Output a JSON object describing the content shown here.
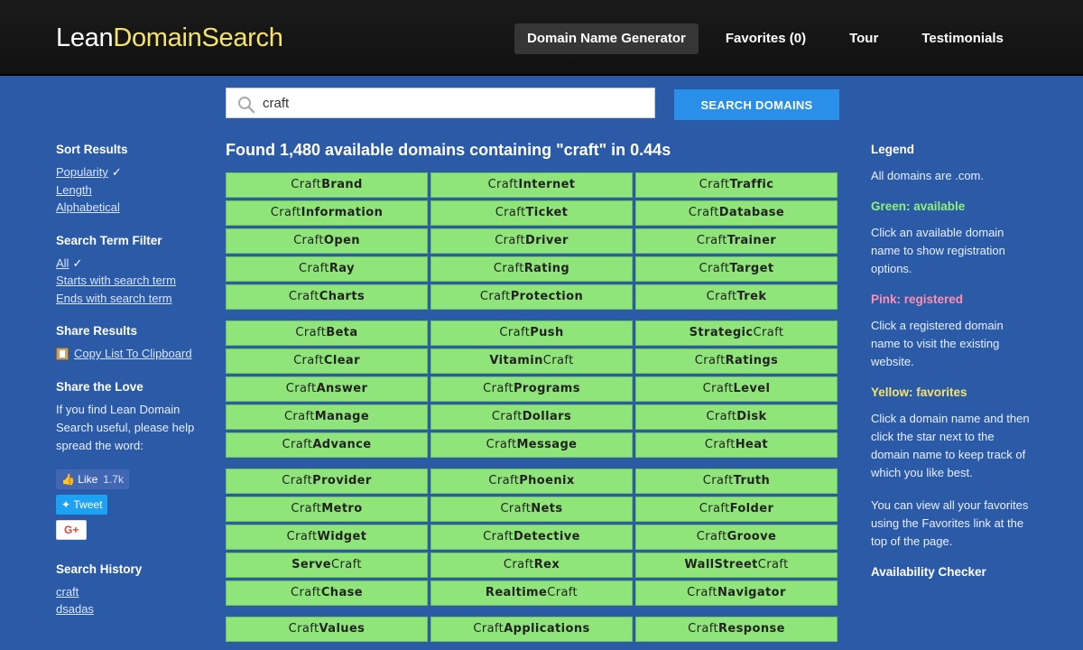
{
  "logo": {
    "part1": "Lean",
    "part2": "DomainSearch"
  },
  "nav": [
    "Domain Name Generator",
    "Favorites (0)",
    "Tour",
    "Testimonials"
  ],
  "search": {
    "value": "craft",
    "button": "SEARCH DOMAINS"
  },
  "result_heading": "Found 1,480 available domains containing \"craft\" in 0.44s",
  "left": {
    "sort_heading": "Sort Results",
    "sort_items": [
      "Popularity",
      "Length",
      "Alphabetical"
    ],
    "check": "✓",
    "filter_heading": "Search Term Filter",
    "filter_items": [
      "All",
      "Starts with search term",
      "Ends with search term"
    ],
    "share_heading": "Share Results",
    "copy_link": "Copy List To Clipboard",
    "love_heading": "Share the Love",
    "love_text": "If you find Lean Domain Search useful, please help spread the word:",
    "like": "Like",
    "like_count": "1.7k",
    "tweet": "Tweet",
    "gplus": "G+",
    "history_heading": "Search History",
    "history": [
      "craft",
      "dsadas"
    ]
  },
  "right": {
    "legend_heading": "Legend",
    "all_com": "All domains are .com.",
    "green_label": "Green: available",
    "green_text": "Click an available domain name to show registration options.",
    "pink_label": "Pink: registered",
    "pink_text": "Click a registered domain name to visit the existing website.",
    "yellow_label": "Yellow: favorites",
    "yellow_text": "Click a domain name and then click the star next to the domain name to keep track of which you like best.",
    "fav_text": "You can view all your favorites using the Favorites link at the top of the page.",
    "checker_heading": "Availability Checker"
  },
  "domains": [
    [
      [
        "Craft",
        "Brand"
      ],
      [
        "Craft",
        "Internet"
      ],
      [
        "Craft",
        "Traffic"
      ]
    ],
    [
      [
        "Craft",
        "Information"
      ],
      [
        "Craft",
        "Ticket"
      ],
      [
        "Craft",
        "Database"
      ]
    ],
    [
      [
        "Craft",
        "Open"
      ],
      [
        "Craft",
        "Driver"
      ],
      [
        "Craft",
        "Trainer"
      ]
    ],
    [
      [
        "Craft",
        "Ray"
      ],
      [
        "Craft",
        "Rating"
      ],
      [
        "Craft",
        "Target"
      ]
    ],
    [
      [
        "Craft",
        "Charts"
      ],
      [
        "Craft",
        "Protection"
      ],
      [
        "Craft",
        "Trek"
      ]
    ],
    [
      [
        "Craft",
        "Beta"
      ],
      [
        "Craft",
        "Push"
      ],
      [
        "Strategic",
        "Craft"
      ]
    ],
    [
      [
        "Craft",
        "Clear"
      ],
      [
        "Vitamin",
        "Craft"
      ],
      [
        "Craft",
        "Ratings"
      ]
    ],
    [
      [
        "Craft",
        "Answer"
      ],
      [
        "Craft",
        "Programs"
      ],
      [
        "Craft",
        "Level"
      ]
    ],
    [
      [
        "Craft",
        "Manage"
      ],
      [
        "Craft",
        "Dollars"
      ],
      [
        "Craft",
        "Disk"
      ]
    ],
    [
      [
        "Craft",
        "Advance"
      ],
      [
        "Craft",
        "Message"
      ],
      [
        "Craft",
        "Heat"
      ]
    ],
    [
      [
        "Craft",
        "Provider"
      ],
      [
        "Craft",
        "Phoenix"
      ],
      [
        "Craft",
        "Truth"
      ]
    ],
    [
      [
        "Craft",
        "Metro"
      ],
      [
        "Craft",
        "Nets"
      ],
      [
        "Craft",
        "Folder"
      ]
    ],
    [
      [
        "Craft",
        "Widget"
      ],
      [
        "Craft",
        "Detective"
      ],
      [
        "Craft",
        "Groove"
      ]
    ],
    [
      [
        "Serve",
        "Craft"
      ],
      [
        "Craft",
        "Rex"
      ],
      [
        "WallStreet",
        "Craft"
      ]
    ],
    [
      [
        "Craft",
        "Chase"
      ],
      [
        "Realtime",
        "Craft"
      ],
      [
        "Craft",
        "Navigator"
      ]
    ],
    [
      [
        "Craft",
        "Values"
      ],
      [
        "Craft",
        "Applications"
      ],
      [
        "Craft",
        "Response"
      ]
    ]
  ]
}
